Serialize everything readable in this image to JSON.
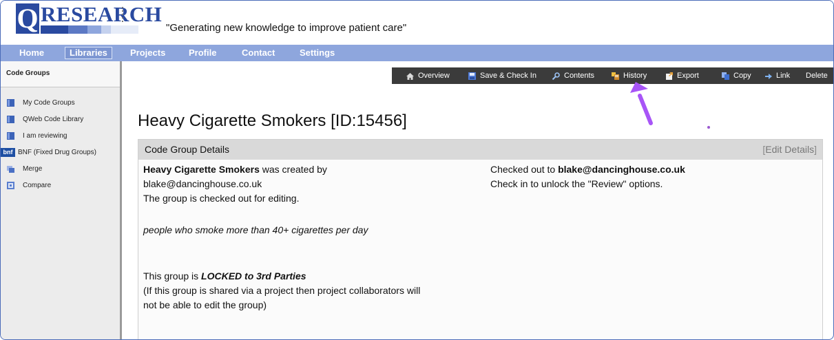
{
  "header": {
    "logo_q": "Q",
    "logo_word": "RESEARCH",
    "tagline": "\"Generating new knowledge to improve patient care\"",
    "brand_color": "#2a4aa0"
  },
  "nav": {
    "items": [
      {
        "label": "Home"
      },
      {
        "label": "Libraries",
        "active": true
      },
      {
        "label": "Projects"
      },
      {
        "label": "Profile"
      },
      {
        "label": "Contact"
      },
      {
        "label": "Settings"
      }
    ],
    "color": "#8ea6dd"
  },
  "sidebar": {
    "title": "Code Groups",
    "items": [
      {
        "label": "My Code Groups",
        "icon": "book-icon"
      },
      {
        "label": "QWeb Code Library",
        "icon": "book-icon"
      },
      {
        "label": "I am reviewing",
        "icon": "book-icon"
      },
      {
        "label": "BNF (Fixed Drug Groups)",
        "icon": "bnf-icon",
        "badge": "bnf"
      },
      {
        "label": "Merge",
        "icon": "merge-icon"
      },
      {
        "label": "Compare",
        "icon": "compare-icon"
      }
    ]
  },
  "toolbar": {
    "items": [
      {
        "label": "Overview",
        "icon": "home-icon"
      },
      {
        "label": "Save & Check In",
        "icon": "save-icon"
      },
      {
        "label": "Contents",
        "icon": "magnifier-icon"
      },
      {
        "label": "History",
        "icon": "history-icon"
      },
      {
        "label": "Export",
        "icon": "export-icon"
      },
      {
        "label": "Copy",
        "icon": "copy-icon"
      },
      {
        "label": "Link",
        "icon": "link-icon"
      },
      {
        "label": "Delete",
        "icon": ""
      }
    ]
  },
  "page": {
    "title": "Heavy Cigarette Smokers [ID:15456]"
  },
  "panel": {
    "title": "Code Group Details",
    "edit_open": "[",
    "edit_label": "Edit Details",
    "edit_close": "]",
    "group_name": "Heavy Cigarette Smokers",
    "created_by_text": " was created by",
    "creator_email": "blake@dancinghouse.co.uk",
    "checked_out_text": "The group is checked out for editing.",
    "description": "people who smoke more than 40+ cigarettes per day",
    "locked_prefix": "This group is ",
    "locked_value": "LOCKED to 3rd Parties",
    "shared_note_1": "(If this group is shared via a project then project collaborators will",
    "shared_note_2": "not be able to edit the group)",
    "checked_out_to_prefix": "Checked out to ",
    "checked_out_to_email": "blake@dancinghouse.co.uk",
    "check_in_note": "Check in to unlock the \"Review\" options."
  },
  "annotation": {
    "arrow_color": "#a855f7"
  }
}
